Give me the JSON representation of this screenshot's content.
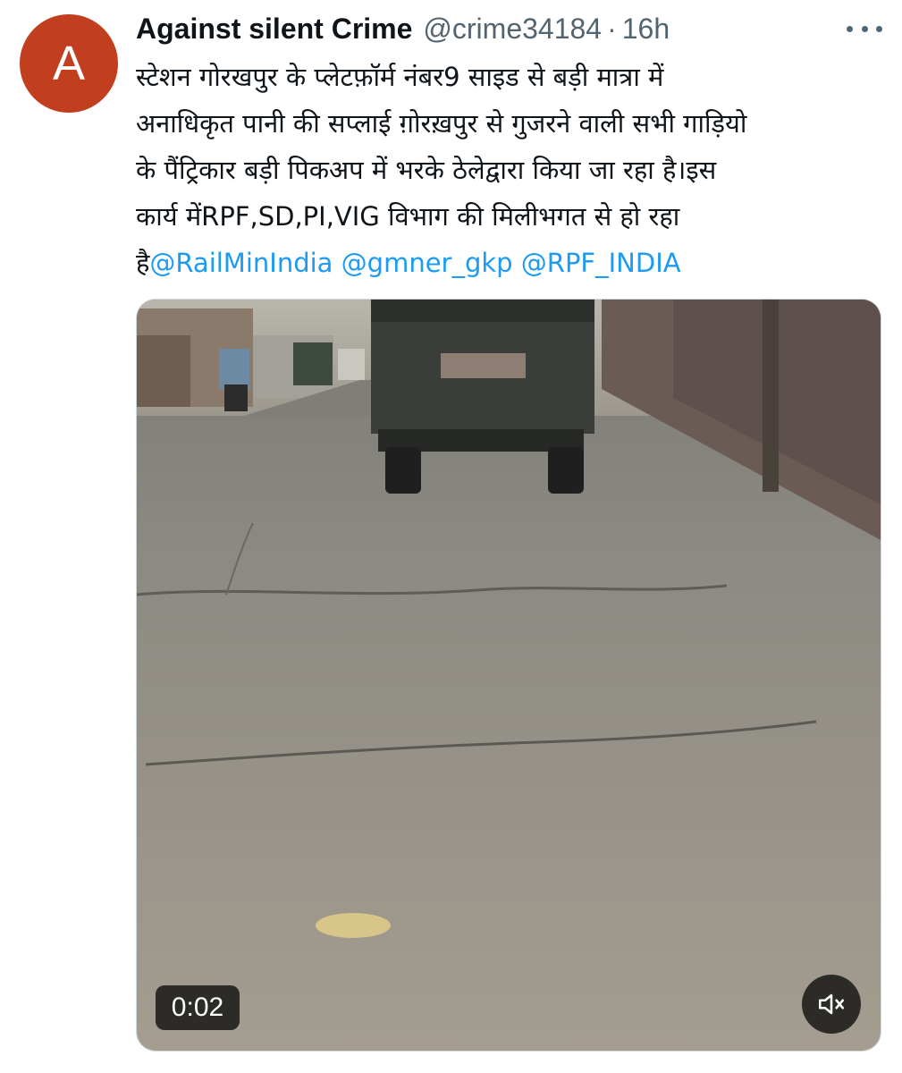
{
  "tweet": {
    "avatar_letter": "A",
    "display_name": "Against silent Crime",
    "handle": "@crime34184",
    "separator": "·",
    "time": "16h",
    "text_lines": [
      "स्टेशन गोरखपुर के प्लेटफ़ॉर्म नंबर9 साइड से बड़ी मात्रा में",
      "अनाधिकृत पानी की सप्लाई ग़ोरख़पुर से गुजरने वाली सभी गाड़ियो",
      "के पैंट्रिकार बड़ी पिकअप में भरके ठेलेद्वारा किया जा रहा है।इस",
      "कार्य मेंRPF,SD,PI,VIG विभाग की मिलीभगत से हो रहा"
    ],
    "last_line_prefix": "है",
    "mentions": [
      "@RailMinIndia",
      "@gmner_gkp",
      "@RPF_INDIA"
    ]
  },
  "video": {
    "duration": "0:02"
  },
  "icons": {
    "more": "more-horizontal-icon",
    "mute": "volume-muted-icon"
  },
  "colors": {
    "avatar_bg": "#c13e1f",
    "link": "#1d9bf0",
    "secondary_text": "#536471",
    "primary_text": "#0f1419"
  }
}
